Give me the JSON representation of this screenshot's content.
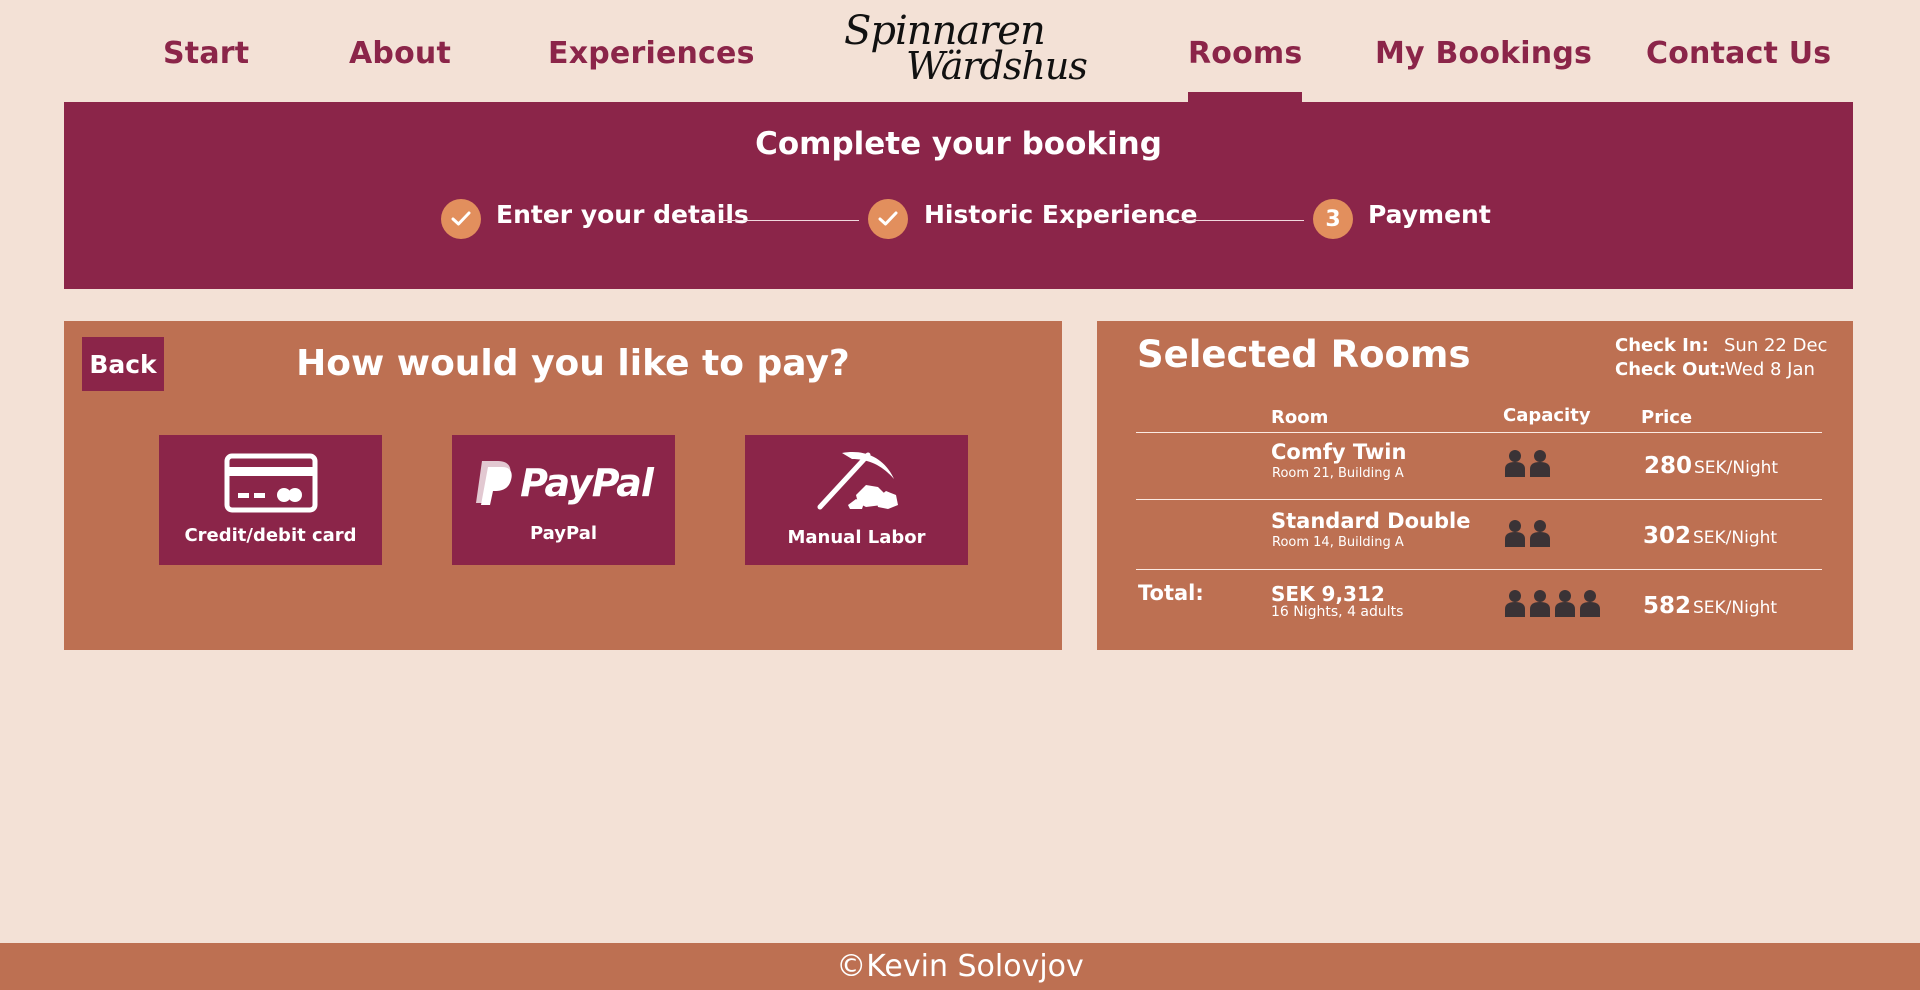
{
  "nav": {
    "items": [
      {
        "label": "Start"
      },
      {
        "label": "About"
      },
      {
        "label": "Experiences"
      },
      {
        "label": "Rooms",
        "active": true
      },
      {
        "label": "My Bookings"
      },
      {
        "label": "Contact Us"
      }
    ],
    "logo": {
      "line1": "Spinnaren",
      "line2": "Wärdshus"
    }
  },
  "banner": {
    "title": "Complete your booking",
    "steps": [
      {
        "label": "Enter your details",
        "state": "done",
        "icon": "check-icon"
      },
      {
        "label": "Historic Experience",
        "state": "done",
        "icon": "check-icon"
      },
      {
        "label": "Payment",
        "state": "current",
        "number": "3"
      }
    ]
  },
  "payment": {
    "back_label": "Back",
    "title": "How would you like to pay?",
    "options": [
      {
        "label": "Credit/debit card",
        "icon": "credit-card-icon"
      },
      {
        "label": "PayPal",
        "icon": "paypal-logo-icon",
        "logo_text": "PayPal"
      },
      {
        "label": "Manual Labor",
        "icon": "pickaxe-rocks-icon"
      }
    ]
  },
  "rooms": {
    "title": "Selected Rooms",
    "check_in_label": "Check In:",
    "check_in_value": "Sun 22 Dec",
    "check_out_label": "Check Out:",
    "check_out_value": "Wed 8 Jan",
    "columns": {
      "room": "Room",
      "capacity": "Capacity",
      "price": "Price"
    },
    "items": [
      {
        "name": "Comfy Twin",
        "location": "Room 21, Building A",
        "capacity": 2,
        "price": "280",
        "unit": "SEK/Night"
      },
      {
        "name": "Standard Double",
        "location": "Room 14, Building A",
        "capacity": 2,
        "price": "302",
        "unit": "SEK/Night"
      }
    ],
    "total": {
      "label": "Total:",
      "amount": "SEK 9,312",
      "details": "16 Nights, 4 adults",
      "capacity": 4,
      "price": "582",
      "unit": "SEK/Night"
    }
  },
  "footer": {
    "text": "©Kevin Solovjov"
  },
  "colors": {
    "background": "#f3e1d6",
    "primary": "#8b2549",
    "panel": "#bd7052",
    "accent": "#e28f5d",
    "person_icon": "#3a3336"
  }
}
